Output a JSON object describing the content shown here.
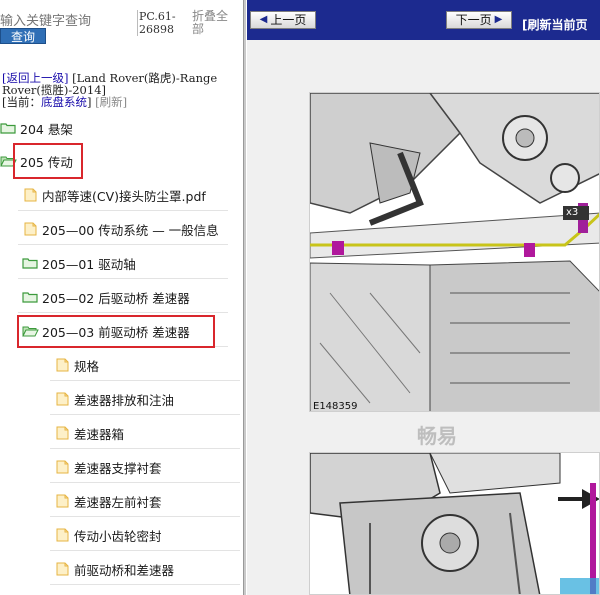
{
  "search": {
    "placeholder": "输入关键字查询",
    "button_label": "查询"
  },
  "header": {
    "pc_code": "PC.61-26898",
    "collapse_label": "折叠全部"
  },
  "nav": {
    "back_link": "[返回上一级]",
    "vehicle": "[Land Rover(路虎)-Range Rover(揽胜)-2014]",
    "current_prefix": "[当前：",
    "current": "底盘系统",
    "current_suffix": "]",
    "refresh": "[刷新]"
  },
  "tree": [
    {
      "label": "204 悬架",
      "type": "folder"
    },
    {
      "label": "205 传动",
      "type": "folder-open"
    },
    {
      "label": "内部等速(CV)接头防尘罩.pdf",
      "type": "file"
    },
    {
      "label": "205—00 传动系统 — 一般信息",
      "type": "file"
    },
    {
      "label": "205—01 驱动轴",
      "type": "folder"
    },
    {
      "label": "205—02 后驱动桥 差速器",
      "type": "folder"
    },
    {
      "label": "205—03 前驱动桥 差速器",
      "type": "folder-open"
    },
    {
      "label": "规格",
      "type": "file"
    },
    {
      "label": "差速器排放和注油",
      "type": "file"
    },
    {
      "label": "差速器箱",
      "type": "file"
    },
    {
      "label": "差速器支撑衬套",
      "type": "file"
    },
    {
      "label": "差速器左前衬套",
      "type": "file"
    },
    {
      "label": "传动小齿轮密封",
      "type": "file"
    },
    {
      "label": "前驱动桥和差速器",
      "type": "file"
    }
  ],
  "viewer": {
    "prev_label": "上一页",
    "next_label": "下一页",
    "refresh_label": "[刷新当前页",
    "figure1_label": "E148359",
    "callout": "x3",
    "watermark": "畅易"
  },
  "colors": {
    "topbar": "#1c2a8f",
    "highlight": "#d9262c",
    "folder": "#5cb85c",
    "file": "#f3cf73",
    "button": "#2f6fb6"
  }
}
